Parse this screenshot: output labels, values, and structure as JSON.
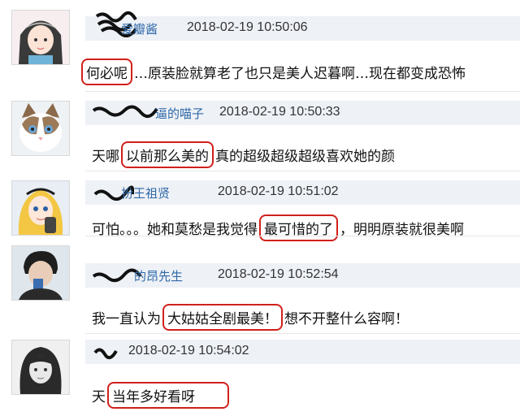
{
  "comments": [
    {
      "username_visible": "爱瓣酱",
      "time": "2018-02-19 10:50:06",
      "highlight": "何必呢",
      "text_after": "…原装脸就算老了也只是美人迟暮啊…现在都变成恐怖",
      "text_before": ""
    },
    {
      "username_visible": "逼的喵子",
      "time": "2018-02-19 10:50:33",
      "text_before": "天哪",
      "highlight": "以前那么美的",
      "text_after": "真的超级超级超级喜欢她的颜"
    },
    {
      "username_visible": "扮王祖贤",
      "time": "2018-02-19 10:51:02",
      "text_before": "可怕。。。她和莫愁是我觉得",
      "highlight": "最可惜的了",
      "text_after": "，明明原装就很美啊"
    },
    {
      "username_visible": "的昂先生",
      "time": "2018-02-19 10:52:54",
      "text_before": "我一直认为",
      "highlight": "大姑姑全剧最美！",
      "text_after": "想不开整什么容啊！"
    },
    {
      "username_visible": "",
      "time": "2018-02-19 10:54:02",
      "text_before": "天",
      "highlight": "当年多好看呀",
      "text_after": ""
    }
  ],
  "colors": {
    "username": "#2f69a8",
    "header_bg": "#eef1f6",
    "highlight_border": "#d0201b"
  },
  "icons": [
    "avatar-anime-girl",
    "avatar-cat",
    "avatar-alice",
    "avatar-man-drinking",
    "avatar-girl-bw"
  ]
}
